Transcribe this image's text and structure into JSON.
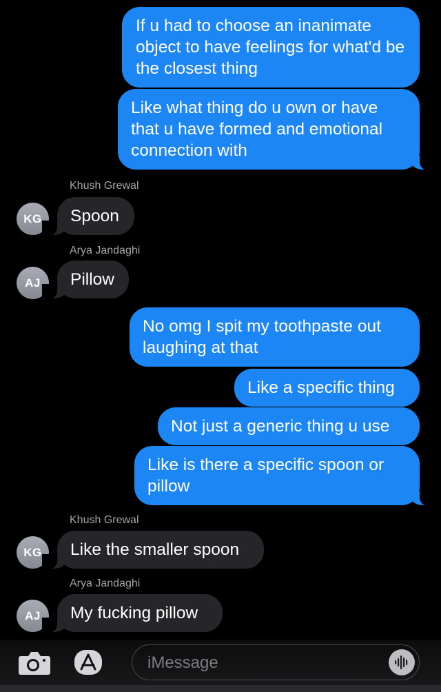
{
  "messages": [
    {
      "id": "m1",
      "type": "sent",
      "text": "If u had to choose an inanimate object to have feelings for what'd be the closest thing"
    },
    {
      "id": "m2",
      "type": "sent",
      "text": "Like what thing do u own or have that u have formed and emotional connection with"
    },
    {
      "id": "m3",
      "type": "received",
      "sender": "Khush Grewal",
      "initials": "KG",
      "text": "Spoon"
    },
    {
      "id": "m4",
      "type": "received",
      "sender": "Arya Jandaghi",
      "initials": "AJ",
      "text": "Pillow"
    },
    {
      "id": "m5",
      "type": "sent",
      "text": "No omg I spit my toothpaste out laughing at that"
    },
    {
      "id": "m6",
      "type": "sent",
      "text": "Like a specific thing"
    },
    {
      "id": "m7",
      "type": "sent",
      "text": "Not just a generic thing u use"
    },
    {
      "id": "m8",
      "type": "sent",
      "text": "Like is there a specific spoon or pillow"
    },
    {
      "id": "m9",
      "type": "received",
      "sender": "Khush Grewal",
      "initials": "KG",
      "text": "Like the smaller spoon"
    },
    {
      "id": "m10",
      "type": "received",
      "sender": "Arya Jandaghi",
      "initials": "AJ",
      "text": "My fucking pillow"
    }
  ],
  "input": {
    "placeholder": "iMessage"
  },
  "icons": {
    "camera": "camera-icon",
    "apps": "app-store-icon",
    "audio": "audio-waveform-icon"
  },
  "colors": {
    "sent_bubble": "#1c86f5",
    "received_bubble": "#26262a",
    "background": "#000000"
  }
}
